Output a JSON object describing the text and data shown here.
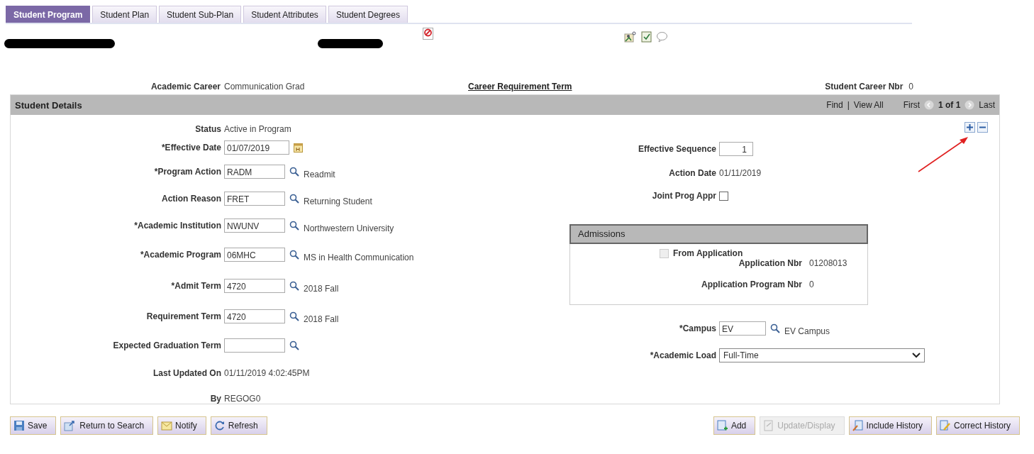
{
  "tabs": [
    {
      "label": "Student Program",
      "selected": true
    },
    {
      "label": "Student Plan",
      "selected": false
    },
    {
      "label": "Student Sub-Plan",
      "selected": false
    },
    {
      "label": "Student Attributes",
      "selected": false
    },
    {
      "label": "Student Degrees",
      "selected": false
    }
  ],
  "career": {
    "label": "Academic Career",
    "value": "Communication Grad",
    "link": "Career Requirement Term",
    "nbr_label": "Student Career Nbr",
    "nbr_value": "0"
  },
  "details": {
    "title": "Student Details",
    "nav": {
      "find": "Find",
      "separator": "|",
      "view_all": "View All",
      "first": "First",
      "count": "1 of 1",
      "last": "Last"
    },
    "left_fields": [
      {
        "kind": "text",
        "label": "Status",
        "value": "Active in Program"
      },
      {
        "kind": "date",
        "label": "*Effective Date",
        "value": "01/07/2019"
      },
      {
        "kind": "lookup",
        "label": "*Program Action",
        "value": "RADM",
        "description": "Readmit"
      },
      {
        "kind": "lookup",
        "label": "Action Reason",
        "value": "FRET",
        "description": "Returning Student"
      },
      {
        "kind": "lookup",
        "label": "*Academic Institution",
        "value": "NWUNV",
        "description": "Northwestern University"
      },
      {
        "kind": "lookup",
        "label": "*Academic Program",
        "value": "06MHC",
        "description": "MS in Health Communication"
      },
      {
        "kind": "lookup",
        "label": "*Admit Term",
        "value": "4720",
        "description": "2018 Fall"
      },
      {
        "kind": "lookup",
        "label": "Requirement Term",
        "value": "4720",
        "description": "2018 Fall"
      },
      {
        "kind": "lookup",
        "label": "Expected Graduation Term"
      },
      {
        "kind": "text",
        "label": "Last Updated On",
        "value": "01/11/2019  4:02:45PM"
      },
      {
        "kind": "text",
        "label": "By",
        "value": "REGOG0"
      }
    ],
    "right_fields": [
      {
        "kind": "number",
        "label": "Effective Sequence",
        "value": "1"
      },
      {
        "kind": "text",
        "label": "Action Date",
        "value": "01/11/2019"
      },
      {
        "kind": "checkbox",
        "label": "Joint Prog Appr",
        "checked": false
      },
      {
        "kind": "admissions",
        "title": "Admissions",
        "checkbox": {
          "label": "From Application",
          "checked": false,
          "disabled": true
        },
        "rows": [
          {
            "label": "Application Nbr",
            "value": "01208013"
          },
          {
            "label": "Application Program Nbr",
            "value": "0"
          }
        ]
      },
      {
        "kind": "lookup",
        "label": "*Campus",
        "value": "EV",
        "description": "EV Campus"
      },
      {
        "kind": "select",
        "label": "*Academic Load",
        "value": "Full-Time"
      }
    ]
  },
  "left_buttons": [
    {
      "label": "Save",
      "kind": "save",
      "disabled": false
    },
    {
      "label": "Return to Search",
      "kind": "return",
      "disabled": false
    },
    {
      "label": "Notify",
      "kind": "notify",
      "disabled": false
    },
    {
      "label": "Refresh",
      "kind": "refresh",
      "disabled": false
    }
  ],
  "right_buttons": [
    {
      "label": "Add",
      "kind": "add",
      "disabled": false
    },
    {
      "label": "Update/Display",
      "kind": "update",
      "disabled": true
    },
    {
      "label": "Include History",
      "kind": "include",
      "disabled": false
    },
    {
      "label": "Correct History",
      "kind": "correct",
      "disabled": false
    }
  ]
}
